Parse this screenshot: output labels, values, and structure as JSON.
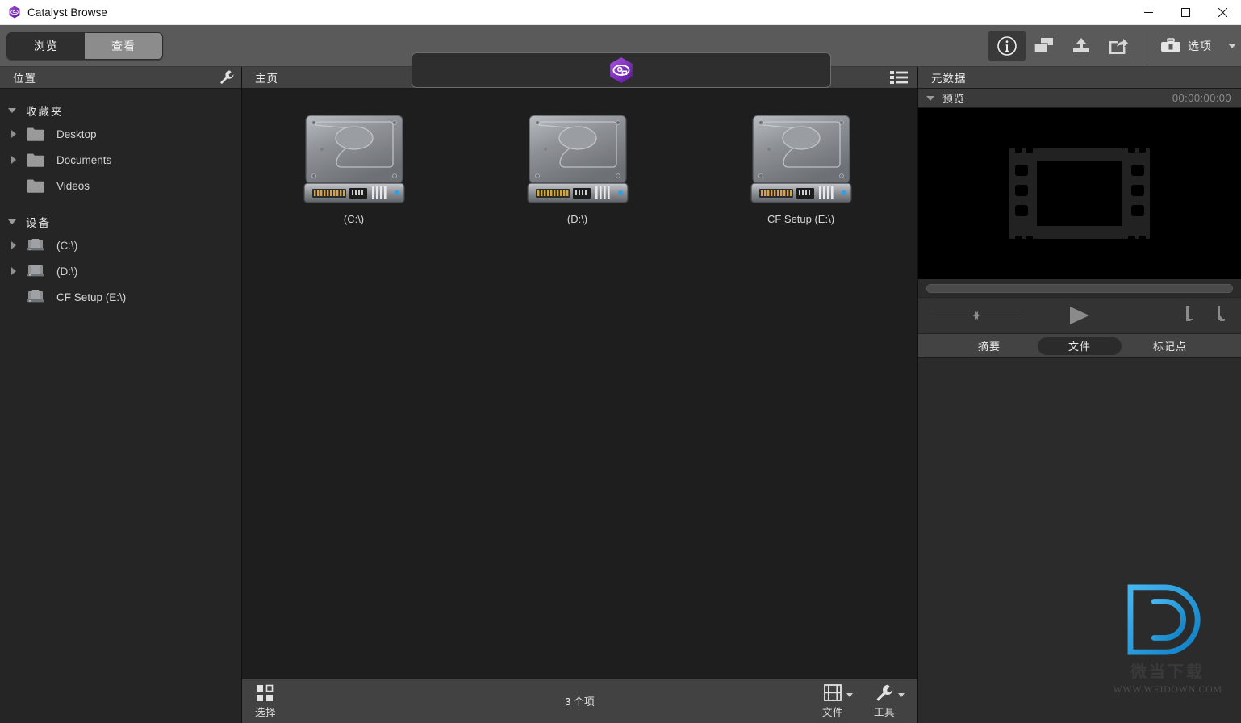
{
  "window": {
    "title": "Catalyst Browse",
    "logo_icon": "catalyst-hex-eye-icon",
    "minimize_label": "–",
    "maximize_label": "□",
    "close_label": "✕"
  },
  "toolbar": {
    "mode_tabs": [
      {
        "label": "浏览",
        "active": true
      },
      {
        "label": "查看",
        "active": false
      }
    ],
    "center_logo_icon": "catalyst-hex-eye-icon",
    "icons": [
      {
        "name": "info-icon",
        "glyph": "i",
        "active": true
      },
      {
        "name": "copy-windows-icon",
        "glyph": "",
        "active": false
      },
      {
        "name": "upload-icon",
        "glyph": "",
        "active": false
      },
      {
        "name": "share-export-icon",
        "glyph": "",
        "active": false
      }
    ],
    "options": {
      "icon": "toolbox-icon",
      "label": "选项",
      "caret": "▾"
    }
  },
  "sidebar": {
    "header": {
      "title": "位置",
      "tool_icon": "wrench-icon"
    },
    "groups": [
      {
        "name": "收藏夹",
        "expanded": true,
        "items": [
          {
            "label": "Desktop",
            "icon": "folder-icon",
            "expandable": true
          },
          {
            "label": "Documents",
            "icon": "folder-icon",
            "expandable": true
          },
          {
            "label": "Videos",
            "icon": "folder-icon",
            "expandable": false
          }
        ]
      },
      {
        "name": "设备",
        "expanded": true,
        "items": [
          {
            "label": "(C:\\)",
            "icon": "drive-icon",
            "expandable": true
          },
          {
            "label": "(D:\\)",
            "icon": "drive-icon",
            "expandable": true
          },
          {
            "label": "CF Setup (E:\\)",
            "icon": "drive-icon",
            "expandable": false
          }
        ]
      }
    ]
  },
  "main": {
    "header": {
      "title": "主页",
      "view_toggle_icon": "list-view-icon"
    },
    "items": [
      {
        "label": "(C:\\)",
        "icon": "hard-drive-icon"
      },
      {
        "label": "(D:\\)",
        "icon": "hard-drive-icon"
      },
      {
        "label": "CF Setup (E:\\)",
        "icon": "hard-drive-icon"
      }
    ],
    "status": {
      "select_label": "选择",
      "select_icon": "selection-grid-icon",
      "count_text": "3 个项",
      "file_label": "文件",
      "file_icon": "film-frame-icon",
      "tools_label": "工具",
      "tools_icon": "wrench-icon"
    }
  },
  "metadata": {
    "header": {
      "title": "元数据"
    },
    "preview": {
      "label": "预览",
      "timecode": "00:00:00:00",
      "placeholder_icon": "film-strip-icon"
    },
    "transport": {
      "shuttle_icon": "shuttle-slider-icon",
      "play_icon": "play-icon",
      "mark_in_icon": "mark-in-icon",
      "mark_out_icon": "mark-out-icon"
    },
    "tabs": [
      {
        "label": "摘要",
        "active": false
      },
      {
        "label": "文件",
        "active": true
      },
      {
        "label": "标记点",
        "active": false
      }
    ]
  },
  "watermark": {
    "logo_icon": "weidown-d-logo",
    "cn_text": "微当下载",
    "url_text": "WWW.WEIDOWN.COM"
  },
  "colors": {
    "accent_purple": "#7b27b5",
    "watermark_blue": "#1f9fe0",
    "panel_head": "#424242",
    "toolbar": "#5a5a5a"
  }
}
